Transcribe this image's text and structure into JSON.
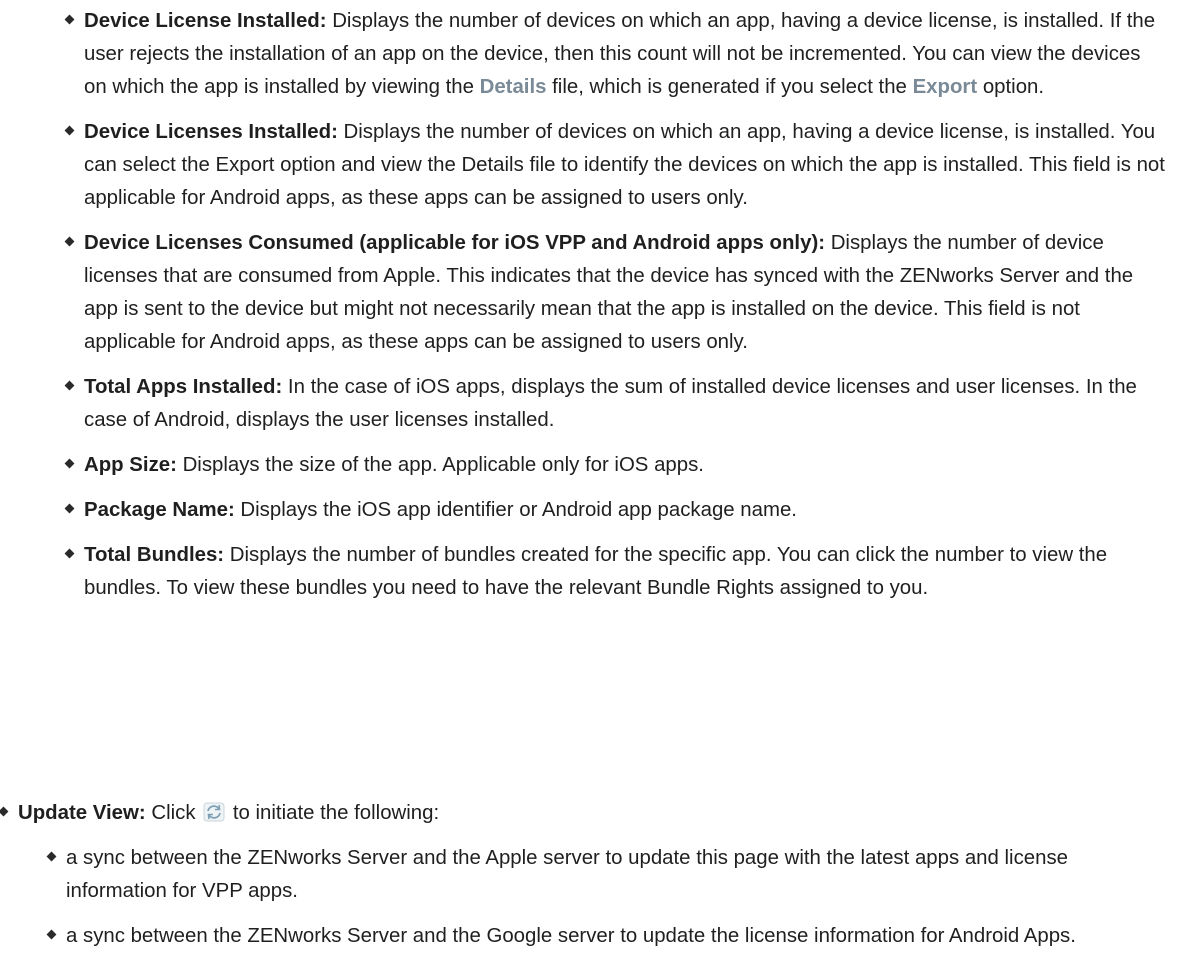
{
  "items": [
    {
      "label": "Device License Installed:",
      "segments": [
        " Displays the number of devices on which an app, having a device license, is installed. If the user rejects the installation of an app on the device, then this count will not be incremented. You can view the devices on which the app is installed by viewing the ",
        "Details",
        " file, which is generated if you select the ",
        "Export",
        " option."
      ]
    },
    {
      "label": "Device Licenses Installed:",
      "text": " Displays the number of devices on which an app, having a device license, is installed. You can select the Export option and view the Details file to identify the devices on which the app is installed. This field is not applicable for Android apps, as these apps can be assigned to users only."
    },
    {
      "label": "Device Licenses Consumed (applicable for iOS VPP and Android apps only):",
      "text": " Displays the number of device licenses that are consumed from Apple. This indicates that the device has synced with the ZENworks Server and the app is sent to the device but might not necessarily mean that the app is installed on the device. This field is not applicable for Android apps, as these apps can be assigned to users only."
    },
    {
      "label": "Total Apps Installed:",
      "text": " In the case of iOS apps, displays the sum of installed device licenses and user licenses. In the case of Android, displays the user licenses installed."
    },
    {
      "label": "App Size:",
      "text": " Displays the size of the app. Applicable only for iOS apps."
    },
    {
      "label": "Package Name:",
      "text": " Displays the iOS app identifier or Android app package name."
    },
    {
      "label": "Total Bundles:",
      "text": " Displays the number of bundles created for the specific app. You can click the number to view the bundles. To view these bundles you need to have the relevant Bundle Rights assigned to you."
    }
  ],
  "update_view": {
    "label": "Update View:",
    "text_before": " Click ",
    "icon": "refresh-icon",
    "text_after": " to initiate the following:",
    "subitems": [
      "a sync between the ZENworks Server and the Apple server to update this page with the latest apps and license information for VPP apps.",
      "a sync between the ZENworks Server and the Google server to update the license information for Android Apps."
    ]
  }
}
